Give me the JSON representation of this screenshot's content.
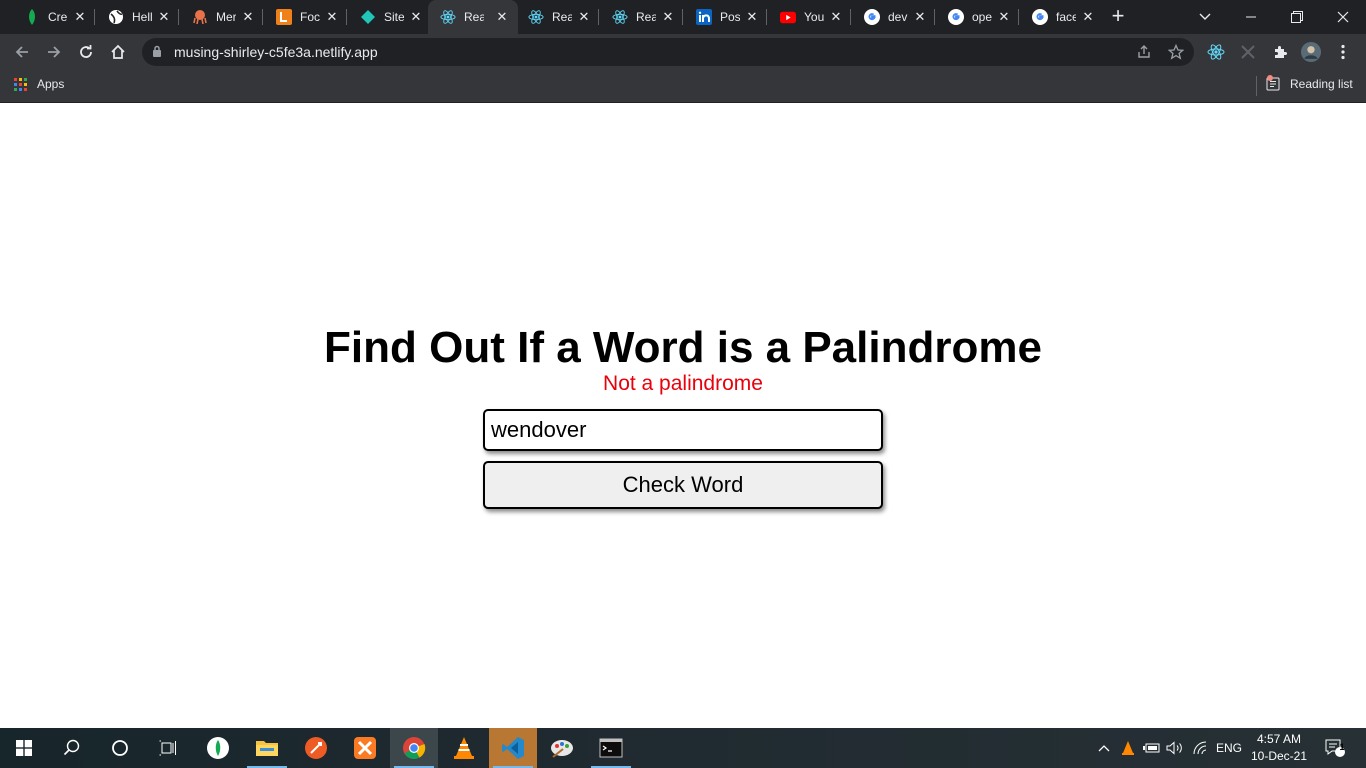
{
  "browser": {
    "tabs": [
      {
        "title": "Cre",
        "icon": "mongodb-leaf-icon",
        "color": "#13aa52"
      },
      {
        "title": "Hell",
        "icon": "globe-icon",
        "color": "#ffffff"
      },
      {
        "title": "Mer",
        "icon": "octopus-icon",
        "color": "#e8734a"
      },
      {
        "title": "Foc",
        "icon": "focus-logo-icon",
        "color": "#f0801a"
      },
      {
        "title": "Site",
        "icon": "netlify-diamond-icon",
        "color": "#20c6b7"
      },
      {
        "title": "Rea",
        "icon": "react-icon",
        "color": "#61dafb",
        "active": true
      },
      {
        "title": "Rea",
        "icon": "react-icon",
        "color": "#61dafb"
      },
      {
        "title": "Rea",
        "icon": "react-icon",
        "color": "#61dafb"
      },
      {
        "title": "Pos",
        "icon": "linkedin-icon",
        "color": "#0a66c2"
      },
      {
        "title": "You",
        "icon": "youtube-icon",
        "color": "#ff0000"
      },
      {
        "title": "dev",
        "icon": "google-icon",
        "color": "#ffffff"
      },
      {
        "title": "ope",
        "icon": "google-icon",
        "color": "#ffffff"
      },
      {
        "title": "face",
        "icon": "google-icon",
        "color": "#ffffff"
      }
    ],
    "url": "musing-shirley-c5fe3a.netlify.app",
    "bookmarks": {
      "apps_label": "Apps",
      "reading_list_label": "Reading list"
    }
  },
  "page": {
    "heading": "Find Out If a Word is a Palindrome",
    "result_text": "Not a palindrome",
    "result_color": "#e8000b",
    "input_value": "wendover",
    "button_label": "Check Word"
  },
  "taskbar": {
    "apps": [
      "start",
      "search",
      "cortana",
      "task-view",
      "mongodb-compass",
      "file-explorer",
      "postman",
      "xampp",
      "chrome",
      "vlc",
      "vscode",
      "paint",
      "terminal"
    ],
    "language": "ENG",
    "time": "4:57 AM",
    "date": "10-Dec-21",
    "notification_count": "1"
  }
}
